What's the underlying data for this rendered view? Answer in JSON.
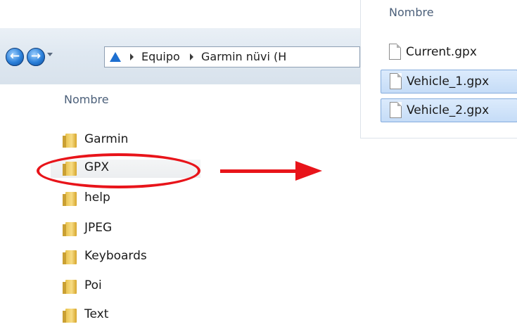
{
  "address_bar": {
    "breadcrumbs": [
      "Equipo",
      "Garmin nüvi (H"
    ]
  },
  "left_panel": {
    "column_header": "Nombre",
    "folders": [
      "Garmin",
      "GPX",
      "help",
      "JPEG",
      "Keyboards",
      "Poi",
      "Text"
    ],
    "highlighted_folder": "GPX"
  },
  "right_panel": {
    "column_header": "Nombre",
    "files": [
      "Current.gpx",
      "Vehicle_1.gpx",
      "Vehicle_2.gpx"
    ],
    "selected_files": [
      "Vehicle_1.gpx",
      "Vehicle_2.gpx"
    ]
  },
  "annotation": {
    "color": "#e8141a",
    "shapes": [
      "ellipse around GPX",
      "arrow pointing right"
    ]
  }
}
